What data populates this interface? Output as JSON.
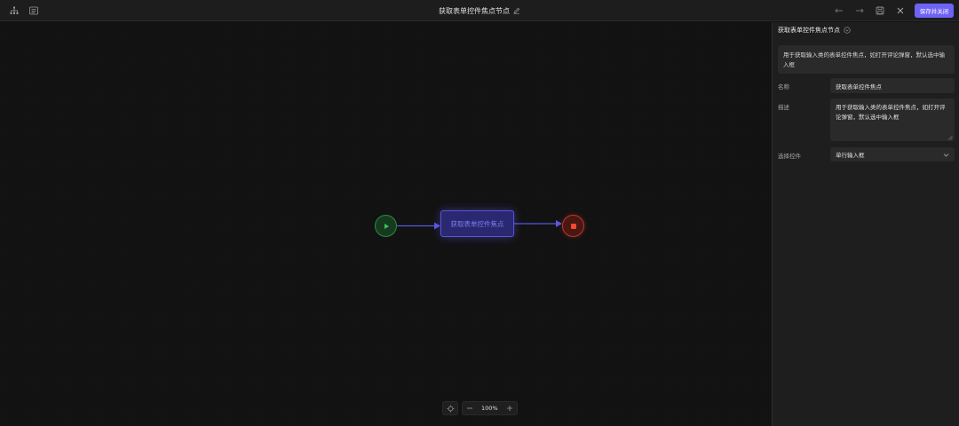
{
  "header": {
    "title": "获取表单控件焦点节点",
    "save_label": "保存并关闭",
    "icons": [
      "flow-tree-icon",
      "list-view-icon",
      "edit-pencil-icon",
      "undo-icon",
      "redo-icon",
      "save-disk-icon",
      "close-icon"
    ]
  },
  "canvas": {
    "process_node_label": "获取表单控件焦点",
    "zoom_level": "100%"
  },
  "panel": {
    "title": "获取表单控件焦点节点",
    "description": "用于获取输入类的表单控件焦点，如打开评论弹窗，默认选中输入框",
    "name_label": "名称",
    "name_value": "获取表单控件焦点",
    "desc_label": "描述",
    "desc_value": "用于获取输入类的表单控件焦点，如打开评论弹窗，默认选中输入框",
    "select_label": "选择控件",
    "select_value": "单行输入框"
  },
  "colors": {
    "accent": "#6e63f5",
    "start_green": "#2f8a44",
    "end_red": "#f04a32",
    "process_border": "#5b55d8"
  }
}
